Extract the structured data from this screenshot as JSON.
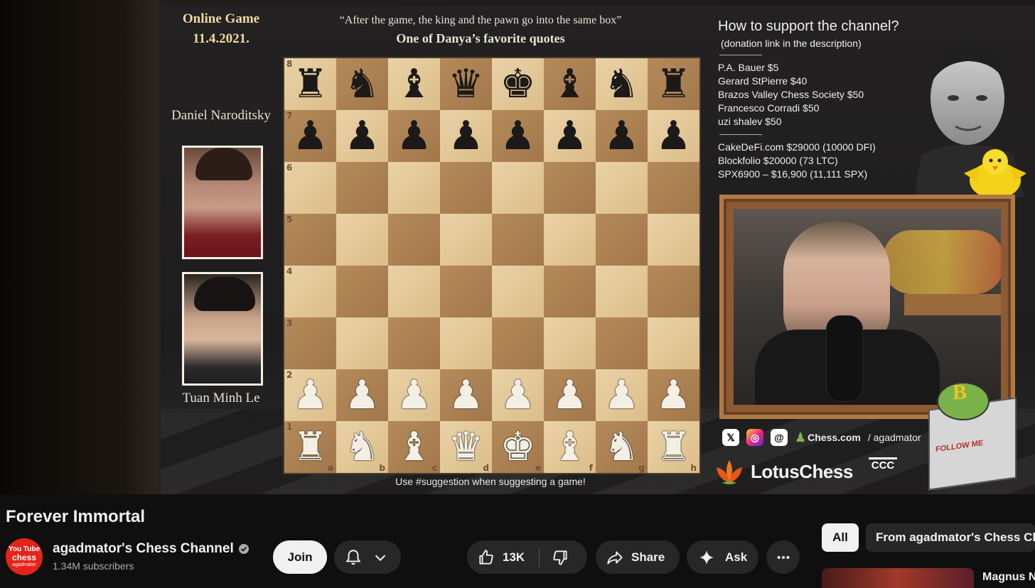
{
  "overlay": {
    "game_label": "Online Game",
    "game_date": "11.4.2021.",
    "quote": "“After the game, the king and the pawn go into the same box”",
    "quote_caption": "One of Danya’s favorite quotes",
    "player_top": "Daniel Naroditsky",
    "player_bottom": "Tuan Minh Le",
    "suggestion_note": "Use #suggestion when suggesting a game!",
    "support_heading": "How to support the channel?",
    "support_sub": "(donation link in the description)",
    "donors": [
      "P.A. Bauer $5",
      "Gerard StPierre $40",
      "Brazos Valley Chess Society $50",
      "Francesco Corradi $50",
      "uzi shalev $50"
    ],
    "sponsors": [
      "CakeDeFi.com $29000 (10000 DFI)",
      "Blockfolio $20000 (73 LTC)",
      "SPX6900 – $16,900 (11,111 SPX)"
    ],
    "social_handle": "/ agadmator",
    "chesscom": "Chess.com",
    "lotus_brand": "LotusChess",
    "ccc_logo": "CCC",
    "follow_me": "FOLLOW ME",
    "b_badge": "B"
  },
  "board": {
    "ranks": [
      "8",
      "7",
      "6",
      "5",
      "4",
      "3",
      "2",
      "1"
    ],
    "files": [
      "a",
      "b",
      "c",
      "d",
      "e",
      "f",
      "g",
      "h"
    ],
    "position": [
      [
        "bR",
        "bN",
        "bB",
        "bQ",
        "bK",
        "bB",
        "bN",
        "bR"
      ],
      [
        "bP",
        "bP",
        "bP",
        "bP",
        "bP",
        "bP",
        "bP",
        "bP"
      ],
      [
        "",
        "",
        "",
        "",
        "",
        "",
        "",
        ""
      ],
      [
        "",
        "",
        "",
        "",
        "",
        "",
        "",
        ""
      ],
      [
        "",
        "",
        "",
        "",
        "",
        "",
        "",
        ""
      ],
      [
        "",
        "",
        "",
        "",
        "",
        "",
        "",
        ""
      ],
      [
        "wP",
        "wP",
        "wP",
        "wP",
        "wP",
        "wP",
        "wP",
        "wP"
      ],
      [
        "wR",
        "wN",
        "wB",
        "wQ",
        "wK",
        "wB",
        "wN",
        "wR"
      ]
    ]
  },
  "video": {
    "title": "Forever Immortal",
    "channel_name": "agadmator's Chess Channel",
    "subscribers": "1.34M subscribers",
    "avatar_top": "You Tube",
    "avatar_mid": "chess",
    "avatar_bottom": "agadmator",
    "join_label": "Join",
    "like_count": "13K",
    "share_label": "Share",
    "ask_label": "Ask"
  },
  "chips": {
    "all": "All",
    "from_channel": "From agadmator's Chess Channel"
  },
  "recommendation": {
    "title": "Magnus N"
  },
  "icons": {
    "verified": "verified-check-icon",
    "bell": "bell-icon",
    "chevron": "chevron-down-icon",
    "like": "thumbs-up-icon",
    "dislike": "thumbs-down-icon",
    "share": "share-arrow-icon",
    "ask": "sparkle-icon",
    "more": "more-dots-icon"
  },
  "colors": {
    "accent_gold": "#efd9a0",
    "yt_red": "#e42419",
    "light_square": "#e9d2a6",
    "dark_square": "#b58a5a"
  }
}
